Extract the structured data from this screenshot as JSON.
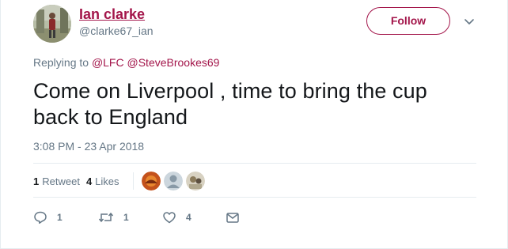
{
  "author": {
    "display_name": "Ian clarke",
    "handle": "@clarke67_ian"
  },
  "follow_label": "Follow",
  "reply_context": {
    "prefix": "Replying to",
    "mentions": [
      "@LFC",
      "@SteveBrookes69"
    ]
  },
  "tweet": {
    "text": "Come on Liverpool , time to bring the cup back to England",
    "timestamp": "3:08 PM - 23 Apr 2018"
  },
  "stats": {
    "retweets_count": "1",
    "retweets_label": "Retweet",
    "likes_count": "4",
    "likes_label": "Likes"
  },
  "actions": {
    "reply_count": "1",
    "retweet_count": "1",
    "like_count": "4"
  },
  "colors": {
    "accent": "#a3154a",
    "muted": "#657786",
    "divider": "#e6ecf0"
  },
  "icons": [
    "chevron-down-icon",
    "reply-icon",
    "retweet-icon",
    "heart-icon",
    "message-icon"
  ]
}
